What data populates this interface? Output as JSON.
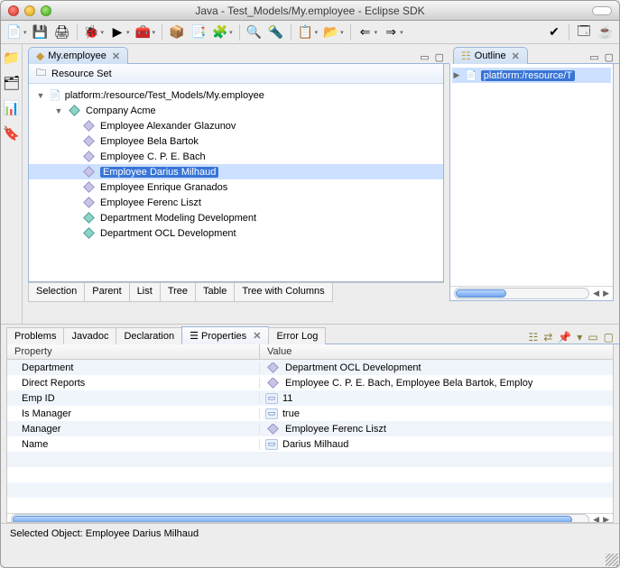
{
  "window": {
    "title": "Java - Test_Models/My.employee - Eclipse SDK"
  },
  "editor": {
    "tab_label": "My.employee",
    "header": "Resource Set",
    "root": "platform:/resource/Test_Models/My.employee",
    "company": "Company Acme",
    "employees": [
      "Employee Alexander Glazunov",
      "Employee Bela Bartok",
      "Employee C. P. E. Bach",
      "Employee Darius Milhaud",
      "Employee Enrique Granados",
      "Employee Ferenc Liszt"
    ],
    "departments": [
      "Department Modeling Development",
      "Department OCL Development"
    ],
    "selected_index": 3,
    "bottom_tabs": [
      "Selection",
      "Parent",
      "List",
      "Tree",
      "Table",
      "Tree with Columns"
    ]
  },
  "outline": {
    "tab_label": "Outline",
    "item": "platform:/resource/T"
  },
  "lower_tabs": [
    "Problems",
    "Javadoc",
    "Declaration",
    "Properties",
    "Error Log"
  ],
  "properties": {
    "col_property": "Property",
    "col_value": "Value",
    "rows": [
      {
        "k": "Department",
        "v": "Department OCL Development",
        "icon": "diamond"
      },
      {
        "k": "Direct Reports",
        "v": "Employee C. P. E. Bach, Employee Bela Bartok, Employ",
        "icon": "diamond"
      },
      {
        "k": "Emp ID",
        "v": "11",
        "icon": "gly"
      },
      {
        "k": "Is Manager",
        "v": "true",
        "icon": "gly"
      },
      {
        "k": "Manager",
        "v": "Employee Ferenc Liszt",
        "icon": "diamond"
      },
      {
        "k": "Name",
        "v": "Darius Milhaud",
        "icon": "gly"
      }
    ]
  },
  "status": "Selected Object: Employee Darius Milhaud"
}
